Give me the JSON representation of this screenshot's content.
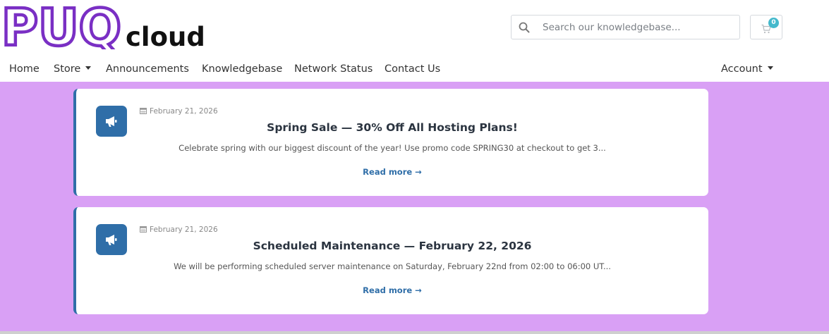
{
  "brand": {
    "logo_mark": "PUQ",
    "logo_text": "cloud",
    "logo_color": "#7a2fc4"
  },
  "search": {
    "placeholder": "Search our knowledgebase...",
    "icon": "search-icon"
  },
  "cart": {
    "icon": "shopping-cart-icon",
    "count": "0",
    "badge_color": "#44b9cc"
  },
  "nav": {
    "items": [
      {
        "label": "Home"
      },
      {
        "label": "Store",
        "dropdown": true
      },
      {
        "label": "Announcements"
      },
      {
        "label": "Knowledgebase"
      },
      {
        "label": "Network Status"
      },
      {
        "label": "Contact Us"
      }
    ],
    "account": {
      "label": "Account",
      "dropdown": true
    }
  },
  "announcements": [
    {
      "date": "February 21, 2026",
      "title": "Spring Sale — 30% Off All Hosting Plans!",
      "summary": "Celebrate spring with our biggest discount of the year! Use promo code SPRING30 at checkout to get 3...",
      "read_more": "Read more →",
      "icon": "megaphone-icon"
    },
    {
      "date": "February 21, 2026",
      "title": "Scheduled Maintenance — February 22, 2026",
      "summary": "We will be performing scheduled server maintenance on Saturday, February 22nd from 02:00 to 06:00 UT...",
      "read_more": "Read more →",
      "icon": "megaphone-icon"
    }
  ],
  "colors": {
    "page_background": "#d9a0f5",
    "accent": "#2f6ea8"
  }
}
